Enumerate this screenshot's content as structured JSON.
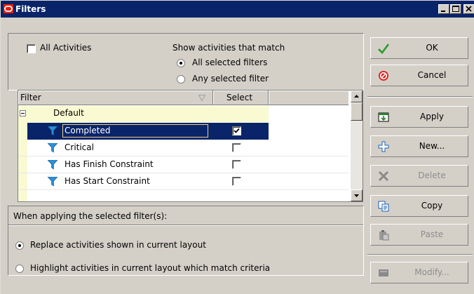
{
  "window": {
    "title": "Filters"
  },
  "top": {
    "all_activities_label": "All Activities",
    "all_activities_checked": false,
    "match_heading": "Show activities that match",
    "match_options": [
      "All selected filters",
      "Any selected filter"
    ],
    "match_selected": "All selected filters"
  },
  "grid": {
    "columns": [
      "Filter",
      "Select"
    ],
    "group": {
      "toggle": "−",
      "label": "Default"
    },
    "rows": [
      {
        "name": "Completed",
        "selected": true,
        "highlighted": true
      },
      {
        "name": "Critical",
        "selected": false,
        "highlighted": false
      },
      {
        "name": "Has Finish Constraint",
        "selected": false,
        "highlighted": false
      },
      {
        "name": "Has Start Constraint",
        "selected": false,
        "highlighted": false
      }
    ]
  },
  "apply_section": {
    "heading": "When applying the selected filter(s):",
    "options": [
      "Replace activities shown in current layout",
      "Highlight activities in current layout which match criteria"
    ],
    "selected": "Replace activities shown in current layout"
  },
  "buttons": {
    "ok": "OK",
    "cancel": "Cancel",
    "apply": "Apply",
    "new": "New...",
    "delete": "Delete",
    "copy": "Copy",
    "paste": "Paste",
    "modify": "Modify..."
  },
  "icons": {
    "app": "oracle-icon",
    "ok": "checkmark-icon",
    "cancel": "no-entry-icon",
    "apply": "apply-icon",
    "new": "plus-icon",
    "delete": "x-icon",
    "copy": "copy-icon",
    "paste": "paste-icon",
    "modify": "modify-icon",
    "filter": "funnel-icon"
  },
  "colors": {
    "titlebar": "#0a246a",
    "selection": "#0a246a",
    "face": "#d4d0c8",
    "gutter": "#fafad2"
  }
}
